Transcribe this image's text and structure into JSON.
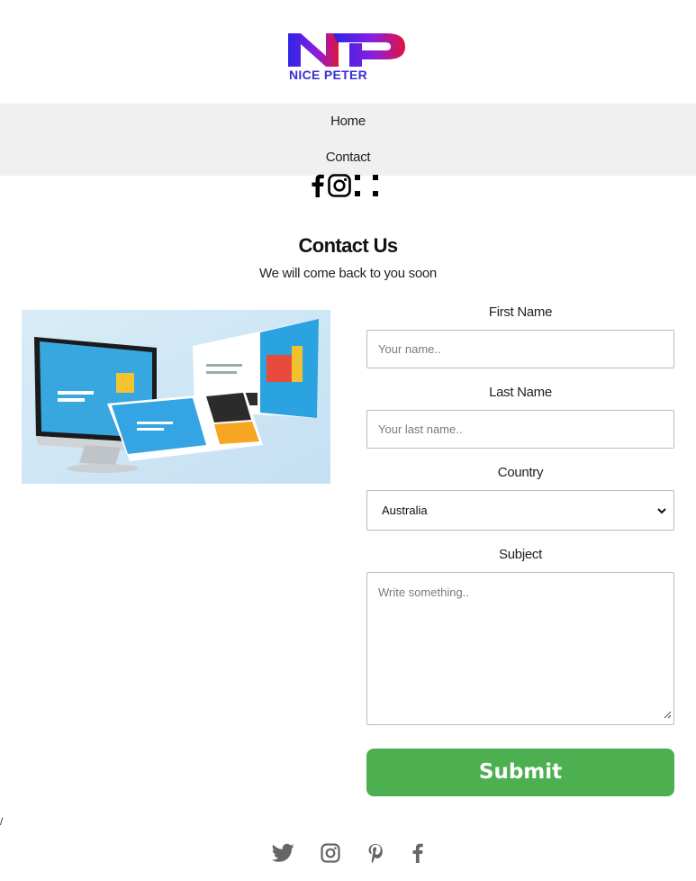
{
  "brand": {
    "logo_initials": "NP",
    "name": "NICE PETER",
    "colors": {
      "gradient_start": "#2b25e6",
      "gradient_end": "#e0143c"
    }
  },
  "nav": {
    "items": [
      {
        "label": "Home"
      },
      {
        "label": "Contact"
      }
    ]
  },
  "social_top": [
    "facebook-icon",
    "instagram-icon",
    "grid-icon"
  ],
  "contact": {
    "title": "Contact Us",
    "subtitle": "We will come back to you soon"
  },
  "form": {
    "first_name": {
      "label": "First Name",
      "placeholder": "Your name.."
    },
    "last_name": {
      "label": "Last Name",
      "placeholder": "Your last name.."
    },
    "country": {
      "label": "Country",
      "selected": "Australia"
    },
    "subject": {
      "label": "Subject",
      "placeholder": "Write something.."
    },
    "submit_label": "Submit",
    "submit_color": "#4caf50"
  },
  "stray_text": "/",
  "social_bottom": [
    "twitter-icon",
    "instagram-icon",
    "pinterest-icon",
    "facebook-icon"
  ]
}
